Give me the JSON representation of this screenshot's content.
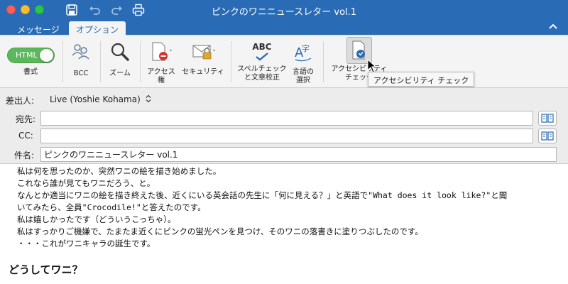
{
  "window": {
    "title": "ピンクのワニニュースレター vol.1"
  },
  "tabs": [
    {
      "label": "メッセージ"
    },
    {
      "label": "オプション"
    }
  ],
  "ribbon": {
    "format_label": "書式",
    "html_toggle_label": "HTML",
    "html_toggle_on": true,
    "bcc_label": "BCC",
    "zoom_label": "ズーム",
    "access_label_1": "アクセス",
    "access_label_2": "権",
    "security_label": "セキュリティ",
    "spellcheck_label_1": "スペルチェック",
    "spellcheck_label_2": "と文章校正",
    "spellcheck_icon_text": "ABC",
    "language_label_1": "言語の",
    "language_label_2": "選択",
    "accessibility_label_1": "アクセシビリティ",
    "accessibility_label_2": "チェック"
  },
  "tooltip": {
    "text": "アクセシビリティ チェック"
  },
  "headers": {
    "from_label": "差出人:",
    "from_value": "Live (Yoshie Kohama)",
    "to_label": "宛先:",
    "to_value": "",
    "cc_label": "CC:",
    "cc_value": "",
    "subject_label": "件名:",
    "subject_value": "ピンクのワニニュースレター vol.1"
  },
  "body": {
    "lines": [
      "私は何を思ったのか、突然ワニの絵を描き始めました。",
      "これなら誰が見てもワニだろう、と。",
      "なんとか適当にワニの絵を描き終えた後、近くにいる英会話の先生に「何に見える？」と英語で\"What does it look like?\"と聞",
      "いてみたら、全員\"Crocodile!\"と答えたのです。",
      "私は嬉しかったです（どういうこっちゃ）。",
      "私はすっかりご機嫌で、たまたま近くにピンクの蛍光ペンを見つけ、そのワニの落書きに塗りつぶしたのです。",
      "・・・これがワニキャラの誕生です。"
    ],
    "heading": "どうしてワニ？"
  },
  "colors": {
    "titlebar": "#2a6bb5",
    "toggle_on": "#5cb85c",
    "close": "#fc5f57",
    "minimize": "#fdbc2e",
    "zoom": "#28c840"
  }
}
